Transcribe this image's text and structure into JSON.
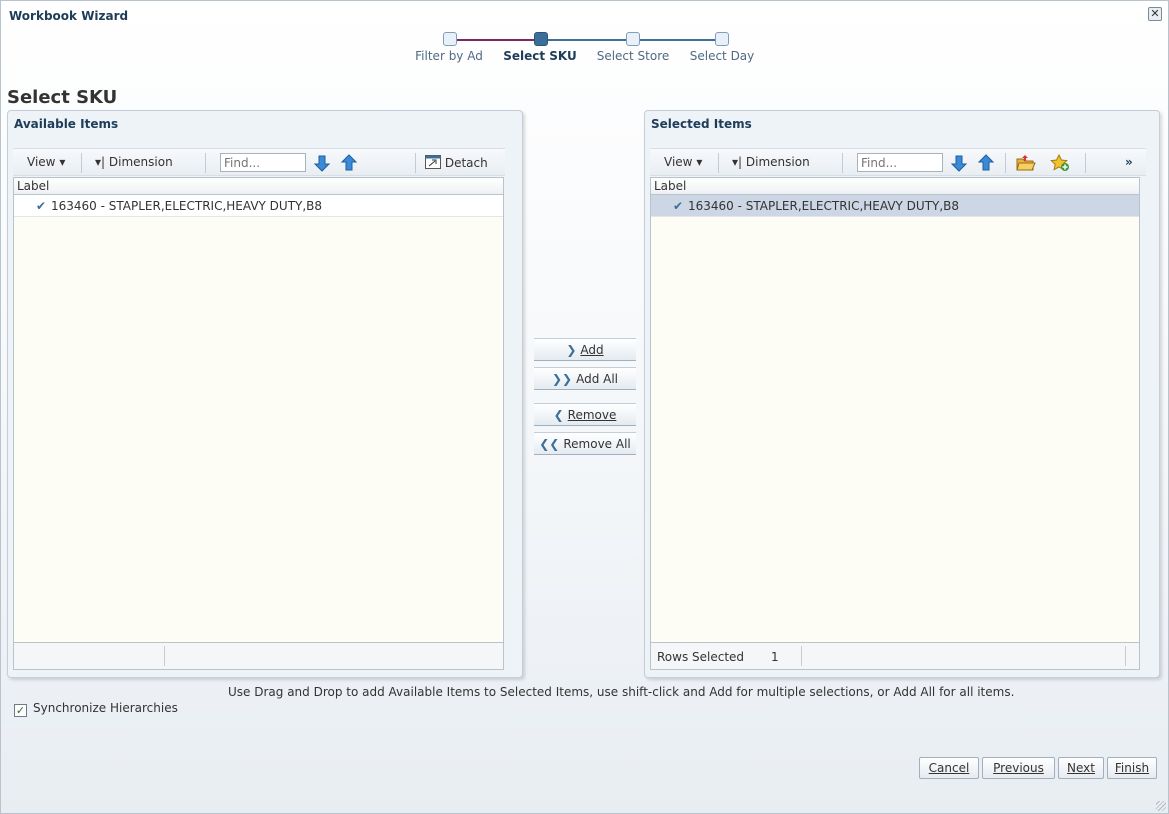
{
  "dialog": {
    "title": "Workbook Wizard"
  },
  "train": {
    "steps": [
      {
        "label": "Filter by Ad",
        "state": "visited"
      },
      {
        "label": "Select SKU",
        "state": "current"
      },
      {
        "label": "Select Store",
        "state": "unvisited"
      },
      {
        "label": "Select Day",
        "state": "unvisited"
      }
    ]
  },
  "page": {
    "title": "Select SKU"
  },
  "available": {
    "header": "Available Items",
    "toolbar": {
      "view": "View",
      "dimension": "Dimension",
      "find_placeholder": "Find...",
      "detach": "Detach"
    },
    "column": "Label",
    "rows": [
      {
        "label": "163460 - STAPLER,ELECTRIC,HEAVY DUTY,B8"
      }
    ]
  },
  "selected": {
    "header": "Selected Items",
    "toolbar": {
      "view": "View",
      "dimension": "Dimension",
      "find_placeholder": "Find..."
    },
    "column": "Label",
    "rows": [
      {
        "label": "163460 - STAPLER,ELECTRIC,HEAVY DUTY,B8"
      }
    ],
    "footer": {
      "rows_selected_label": "Rows Selected",
      "rows_selected_value": "1"
    }
  },
  "shuttle": {
    "add": "Add",
    "add_all": "Add All",
    "remove": "Remove",
    "remove_all": "Remove All"
  },
  "hint": "Use Drag and Drop to add Available Items to Selected Items, use shift-click and Add for multiple selections, or Add All for all items.",
  "sync": {
    "label": "Synchronize Hierarchies",
    "checked": true
  },
  "buttons": {
    "cancel": "Cancel",
    "previous": "Previous",
    "next": "Next",
    "finish": "Finish"
  },
  "colors": {
    "accent": "#1f3c59",
    "train_current": "#3b6e98",
    "train_visited": "#7a2a61"
  }
}
